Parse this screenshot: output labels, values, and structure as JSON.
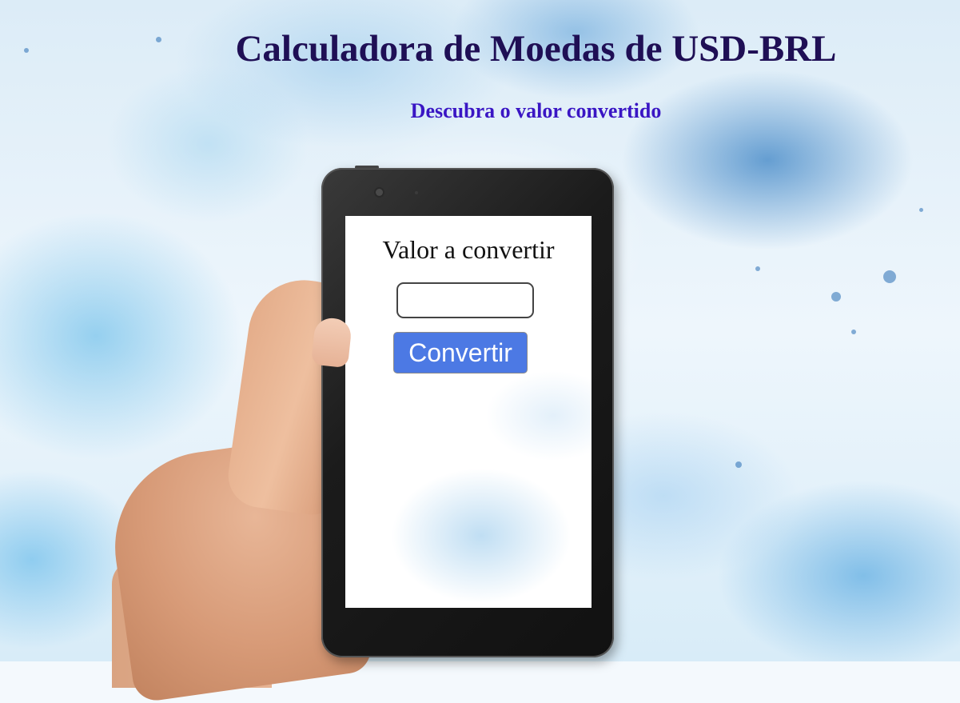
{
  "page": {
    "title": "Calculadora de Moedas de USD-BRL",
    "subtitle": "Descubra o valor convertido"
  },
  "form": {
    "label": "Valor a convertir",
    "input_value": "",
    "button_label": "Convertir"
  },
  "colors": {
    "title": "#1f0f55",
    "subtitle": "#3a16c4",
    "button": "#4c79e4",
    "tablet_frame": "#1b1b1b"
  },
  "decoration": {
    "background": "blue watercolor",
    "illustration": "hand holding tablet"
  }
}
